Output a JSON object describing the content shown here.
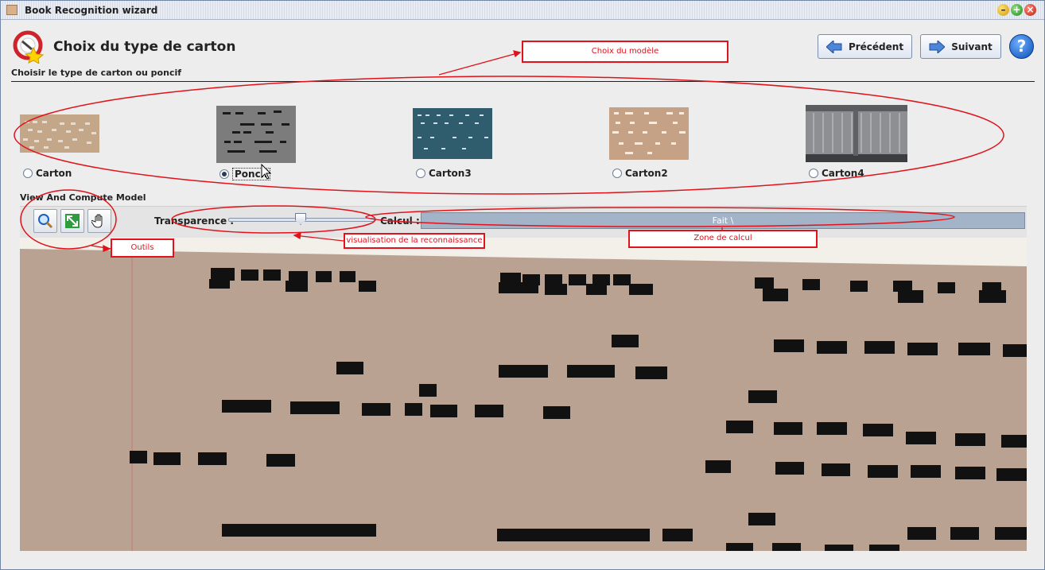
{
  "window": {
    "title": "Book Recognition wizard"
  },
  "header": {
    "title": "Choix du type de carton",
    "subtitle": "Choisir le type de carton ou poncif",
    "prev_label": "Précédent",
    "next_label": "Suivant",
    "help_label": "?"
  },
  "models": [
    {
      "label": "Carton",
      "selected": false
    },
    {
      "label": "Poncif",
      "selected": true
    },
    {
      "label": "Carton3",
      "selected": false
    },
    {
      "label": "Carton2",
      "selected": false
    },
    {
      "label": "Carton4",
      "selected": false
    }
  ],
  "compute": {
    "section_label": "View And Compute Model",
    "transparency_label": "Transparence :",
    "transparency_value": 0.5,
    "calcul_label": "Calcul :",
    "progress_text": "Fait \\",
    "progress_value": 1.0
  },
  "annotations": {
    "model_choice": "Choix du modèle",
    "tools": "Outils",
    "recognition_view": "visualisation de la reconnaissance",
    "compute_zone": "Zone de calcul"
  },
  "colors": {
    "annotation_red": "#e0121b",
    "card_brown": "#b9a291",
    "hole_black": "#111111",
    "progress_blue": "#a3b3c8"
  }
}
